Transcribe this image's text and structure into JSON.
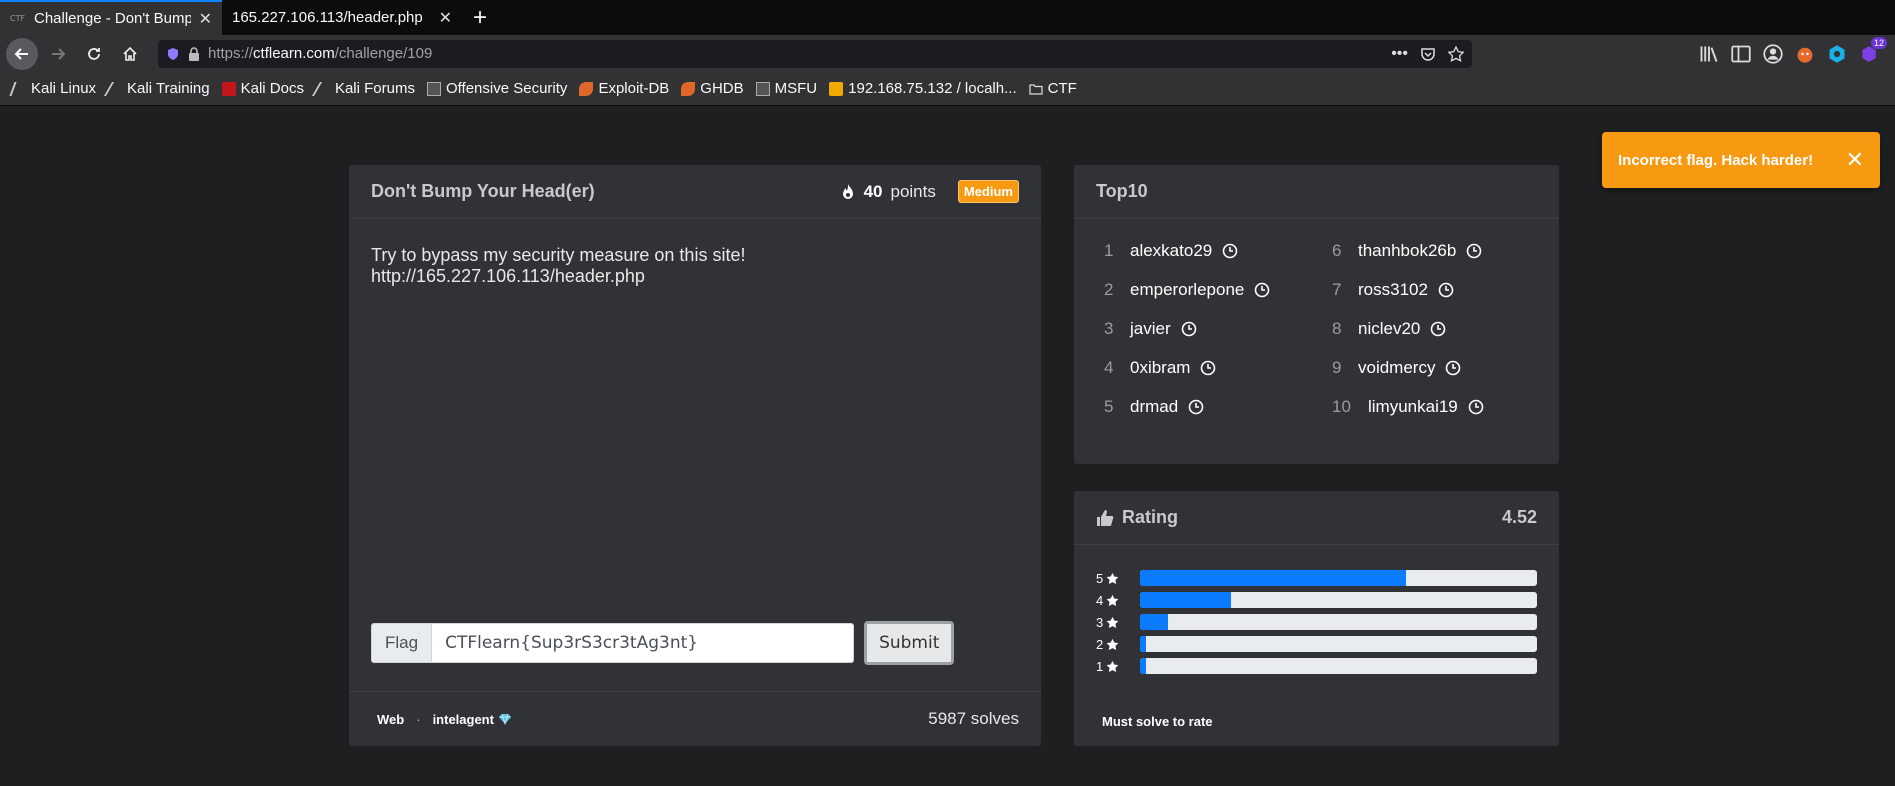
{
  "browser": {
    "tabs": [
      {
        "favicon": "CTF",
        "title": "Challenge - Don't Bump",
        "active": true
      },
      {
        "title": "165.227.106.113/header.php",
        "active": false
      }
    ],
    "url": {
      "prefix": "https://",
      "host": "ctflearn.com",
      "path": "/challenge/109"
    },
    "toolbar_badge": "12",
    "bookmarks": [
      {
        "label": "Kali Linux",
        "icon": "kali-dragon-icon"
      },
      {
        "label": "Kali Training",
        "icon": "kali-dragon-icon"
      },
      {
        "label": "Kali Docs",
        "icon": "docs-icon"
      },
      {
        "label": "Kali Forums",
        "icon": "kali-dragon-icon"
      },
      {
        "label": "Offensive Security",
        "icon": "offsec-icon"
      },
      {
        "label": "Exploit-DB",
        "icon": "exploitdb-icon"
      },
      {
        "label": "GHDB",
        "icon": "ghdb-icon"
      },
      {
        "label": "MSFU",
        "icon": "msfu-icon"
      },
      {
        "label": "192.168.75.132 / localh...",
        "icon": "phpmyadmin-icon"
      },
      {
        "label": "CTF",
        "icon": "folder-icon"
      }
    ]
  },
  "challenge": {
    "title": "Don't Bump Your Head(er)",
    "points_value": "40",
    "points_label": "points",
    "difficulty": "Medium",
    "description": "Try to bypass my security measure on this site! http://165.227.106.113/header.php",
    "flag_label": "Flag",
    "flag_value": "CTFlearn{Sup3rS3cr3tAg3nt}",
    "submit_label": "Submit",
    "category": "Web",
    "separator": "·",
    "author": "intelagent",
    "solves": "5987 solves"
  },
  "top10": {
    "title": "Top10",
    "entries": [
      {
        "rank": "1",
        "name": "alexkato29"
      },
      {
        "rank": "6",
        "name": "thanhbok26b"
      },
      {
        "rank": "2",
        "name": "emperorlepone"
      },
      {
        "rank": "7",
        "name": "ross3102"
      },
      {
        "rank": "3",
        "name": "javier"
      },
      {
        "rank": "8",
        "name": "niclev20"
      },
      {
        "rank": "4",
        "name": "0xibram"
      },
      {
        "rank": "9",
        "name": "voidmercy"
      },
      {
        "rank": "5",
        "name": "drmad"
      },
      {
        "rank": "10",
        "name": "limyunkai19"
      }
    ]
  },
  "rating": {
    "title": "Rating",
    "score": "4.52",
    "bars": [
      {
        "stars": "5",
        "fraction": 0.67
      },
      {
        "stars": "4",
        "fraction": 0.23
      },
      {
        "stars": "3",
        "fraction": 0.07
      },
      {
        "stars": "2",
        "fraction": 0.015
      },
      {
        "stars": "1",
        "fraction": 0.015
      }
    ],
    "note": "Must solve to rate"
  },
  "toast": {
    "message": "Incorrect flag. Hack harder!",
    "color": "#f79a12"
  },
  "colors": {
    "accent": "#0b7bff",
    "difficulty_medium": "#f79a12",
    "card_bg": "#303235"
  }
}
